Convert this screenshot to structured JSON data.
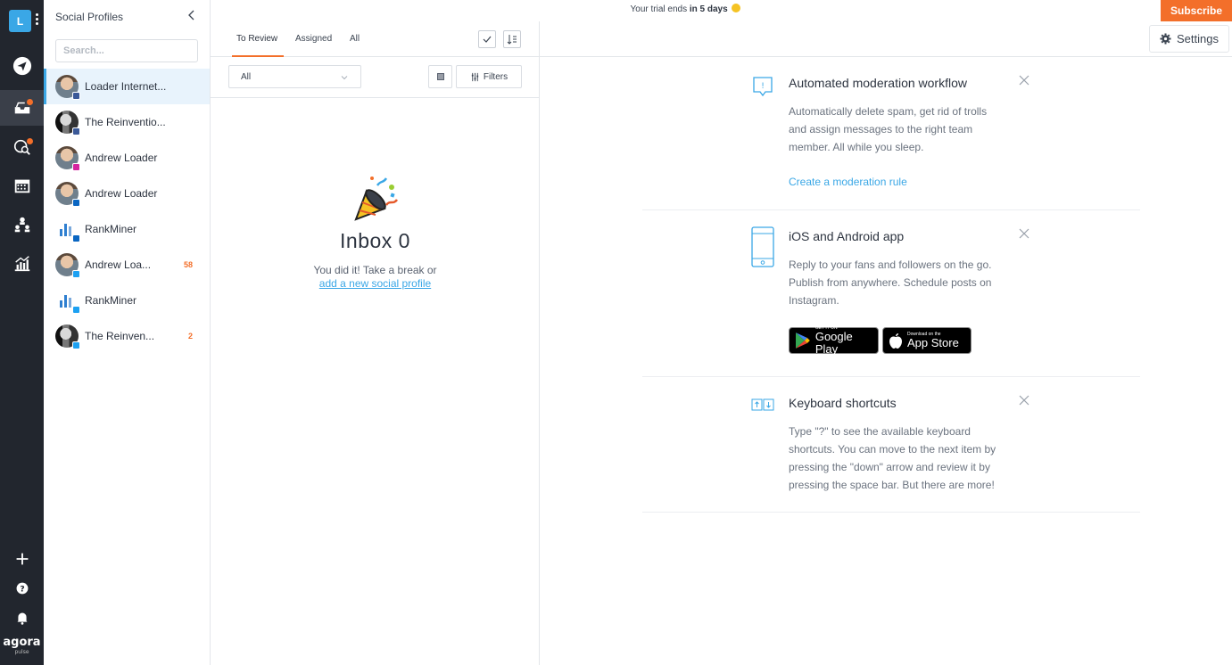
{
  "rail": {
    "user_initial": "L",
    "logo": "agora",
    "logo_sub": "pulse",
    "items": [
      "publish-icon",
      "inbox-icon",
      "listening-icon",
      "calendar-icon",
      "team-icon",
      "reports-icon",
      "add-icon",
      "help-icon",
      "bell-icon"
    ]
  },
  "profiles": {
    "title": "Social Profiles",
    "search_placeholder": "Search...",
    "items": [
      {
        "name": "Loader Internet...",
        "network": "facebook",
        "count": ""
      },
      {
        "name": "The Reinventio...",
        "network": "facebook",
        "count": ""
      },
      {
        "name": "Andrew Loader",
        "network": "instagram",
        "count": ""
      },
      {
        "name": "Andrew Loader",
        "network": "linkedin",
        "count": ""
      },
      {
        "name": "RankMiner",
        "network": "linkedin",
        "count": ""
      },
      {
        "name": "Andrew Loa...",
        "network": "twitter",
        "count": "58"
      },
      {
        "name": "RankMiner",
        "network": "twitter",
        "count": ""
      },
      {
        "name": "The Reinven...",
        "network": "twitter",
        "count": "2"
      }
    ]
  },
  "middle": {
    "tabs": [
      "To Review",
      "Assigned",
      "All"
    ],
    "select_value": "All",
    "filters_label": "Filters",
    "empty_title": "Inbox 0",
    "empty_text": "You did it! Take a break or",
    "empty_link": "add a new social profile"
  },
  "topbar": {
    "trial_prefix": "Your trial ends ",
    "trial_bold": "in 5 days",
    "subscribe": "Subscribe",
    "settings": "Settings"
  },
  "cards": [
    {
      "title": "Automated moderation workflow",
      "lines": [
        "Automatically delete spam, get rid of trolls",
        "and assign messages to the right team",
        "member. All while you sleep."
      ],
      "link": "Create a moderation rule"
    },
    {
      "title": "iOS and Android app",
      "lines": [
        "Reply to your fans and followers on the go.",
        "Publish from anywhere. Schedule posts on",
        "Instagram."
      ],
      "google_small": "GET IT ON",
      "google_big": "Google Play",
      "apple_small": "Download on the",
      "apple_big": "App Store"
    },
    {
      "title": "Keyboard shortcuts",
      "lines": [
        "Type \"?\" to see the available keyboard",
        "shortcuts. You can move to the next item by",
        "pressing the \"down\" arrow and review it by",
        "pressing the space bar. But there are more!"
      ]
    }
  ],
  "colors": {
    "rail": "#22262e",
    "accent": "#f36f2a",
    "link": "#3aa7e6"
  }
}
